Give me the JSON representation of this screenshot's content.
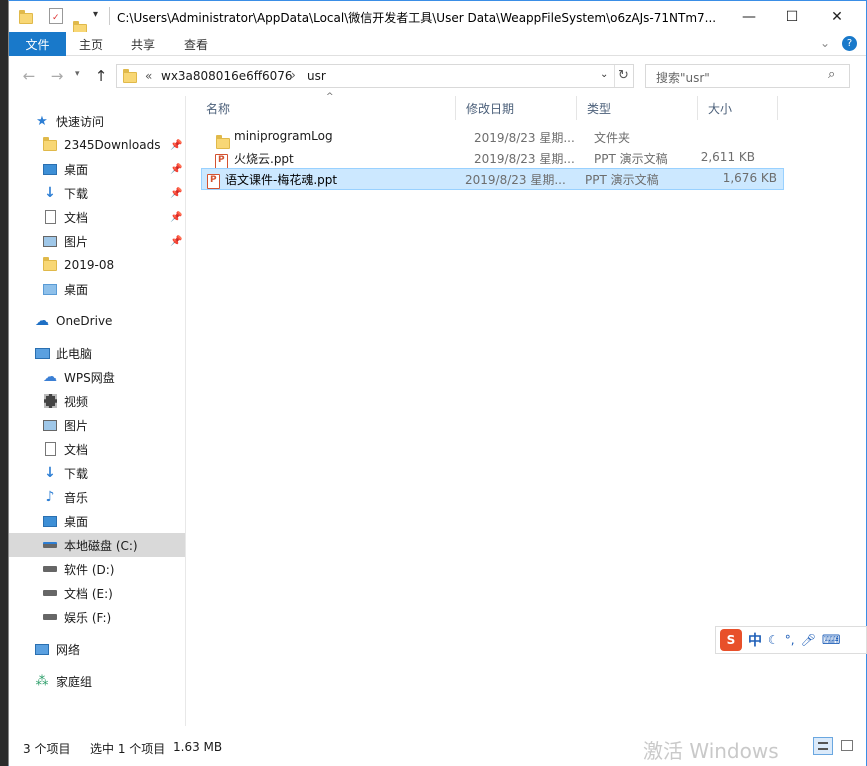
{
  "window": {
    "title": "C:\\Users\\Administrator\\AppData\\Local\\微信开发者工具\\User Data\\WeappFileSystem\\o6zAJs-71NTm7...",
    "minimize": "—",
    "maximize": "☐",
    "close": "✕"
  },
  "ribbon": {
    "tabs": [
      "文件",
      "主页",
      "共享",
      "查看"
    ]
  },
  "address": {
    "prefix": "«",
    "path": [
      "wx3a808016e6ff6076",
      "usr"
    ],
    "sep": "›"
  },
  "search": {
    "placeholder": "搜索\"usr\""
  },
  "sidebar": {
    "items": [
      {
        "label": "快速访问",
        "icon": "star-icon"
      },
      {
        "label": "2345Downloads",
        "icon": "folder-icon",
        "pinned": true
      },
      {
        "label": "桌面",
        "icon": "desktop-icon",
        "pinned": true
      },
      {
        "label": "下载",
        "icon": "download-icon",
        "pinned": true
      },
      {
        "label": "文档",
        "icon": "document-icon",
        "pinned": true
      },
      {
        "label": "图片",
        "icon": "pictures-icon",
        "pinned": true
      },
      {
        "label": "2019-08",
        "icon": "folder-icon"
      },
      {
        "label": "桌面",
        "icon": "desktop-icon"
      },
      {
        "label": "OneDrive",
        "icon": "cloud-icon"
      },
      {
        "label": "此电脑",
        "icon": "computer-icon"
      },
      {
        "label": "WPS网盘",
        "icon": "cloud-icon"
      },
      {
        "label": "视频",
        "icon": "video-icon"
      },
      {
        "label": "图片",
        "icon": "pictures-icon"
      },
      {
        "label": "文档",
        "icon": "document-icon"
      },
      {
        "label": "下载",
        "icon": "download-icon"
      },
      {
        "label": "音乐",
        "icon": "music-icon"
      },
      {
        "label": "桌面",
        "icon": "desktop-icon"
      },
      {
        "label": "本地磁盘 (C:)",
        "icon": "drive-icon",
        "selected": true
      },
      {
        "label": "软件 (D:)",
        "icon": "drive-icon"
      },
      {
        "label": "文档 (E:)",
        "icon": "drive-icon"
      },
      {
        "label": "娱乐 (F:)",
        "icon": "drive-icon"
      },
      {
        "label": "网络",
        "icon": "network-icon"
      },
      {
        "label": "家庭组",
        "icon": "homegroup-icon"
      }
    ]
  },
  "columns": {
    "name": "名称",
    "modified": "修改日期",
    "type": "类型",
    "size": "大小"
  },
  "files": [
    {
      "name": "miniprogramLog",
      "modified": "2019/8/23 星期...",
      "type": "文件夹",
      "size": "",
      "icon": "folder-icon"
    },
    {
      "name": "火烧云.ppt",
      "modified": "2019/8/23 星期...",
      "type": "PPT 演示文稿",
      "size": "2,611 KB",
      "icon": "ppt-icon"
    },
    {
      "name": "语文课件-梅花魂.ppt",
      "modified": "2019/8/23 星期...",
      "type": "PPT 演示文稿",
      "size": "1,676 KB",
      "icon": "ppt-icon",
      "selected": true
    }
  ],
  "status": {
    "count": "3 个项目",
    "selection": "选中 1 个项目",
    "size": "1.63 MB"
  },
  "ime": {
    "mode": "中"
  },
  "watermark": "激活 Windows"
}
